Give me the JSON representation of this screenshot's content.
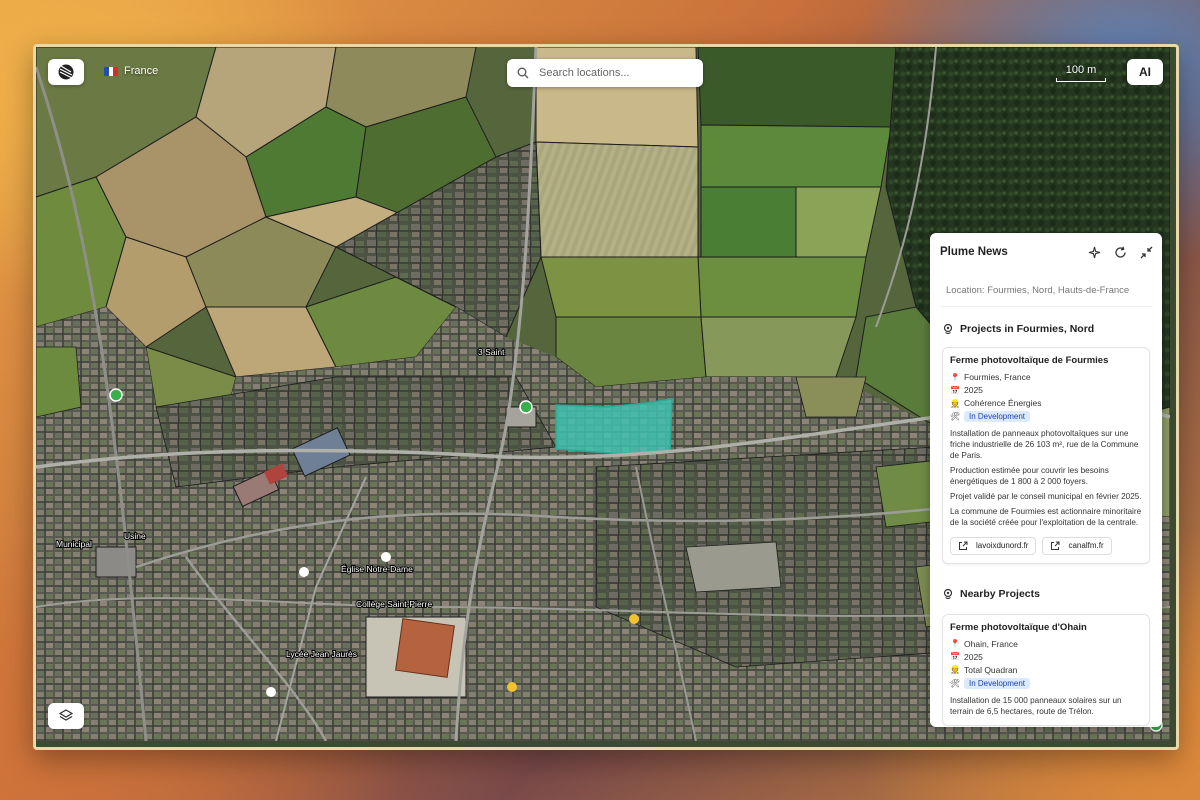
{
  "app": {
    "country": "France",
    "search_placeholder": "Search locations...",
    "scale_label": "100 m",
    "ai_label": "AI"
  },
  "map": {
    "place_labels": [
      "Usine",
      "3 Saint",
      "Église Notre-Dame",
      "Collège Saint-Pierre",
      "Municipal",
      "Lycée Jean Jaurès"
    ]
  },
  "panel": {
    "title": "Plume News",
    "location": "Location: Fourmies, Nord, Hauts-de-France",
    "projects_title": "Projects in Fourmies, Nord",
    "nearby_title": "Nearby Projects",
    "projects": [
      {
        "name": "Ferme photovoltaïque de Fourmies",
        "place": "Fourmies, France",
        "year": "2025",
        "company": "Cohérence Énergies",
        "status": "In Development",
        "desc": [
          "Installation de panneaux photovoltaïques sur une friche industrielle de 26 103 m², rue de la Commune de Paris.",
          "Production estimée pour couvrir les besoins énergétiques de 1 800 à 2 000 foyers.",
          "Projet validé par le conseil municipal en février 2025.",
          "La commune de Fourmies est actionnaire minoritaire de la société créée pour l'exploitation de la centrale."
        ],
        "links": [
          "lavoixdunord.fr",
          "canalfm.fr"
        ]
      }
    ],
    "nearby": [
      {
        "name": "Ferme photovoltaïque d'Ohain",
        "place": "Ohain, France",
        "year": "2025",
        "company": "Total Quadran",
        "status": "In Development",
        "desc": [
          "Installation de 15 000 panneaux solaires sur un terrain de 6,5 hectares, route de Trélon."
        ]
      }
    ]
  },
  "colors": {
    "highlight_area": "#3fc1b0",
    "marker": "#35b04a",
    "badge_bg": "#dbeafe"
  }
}
